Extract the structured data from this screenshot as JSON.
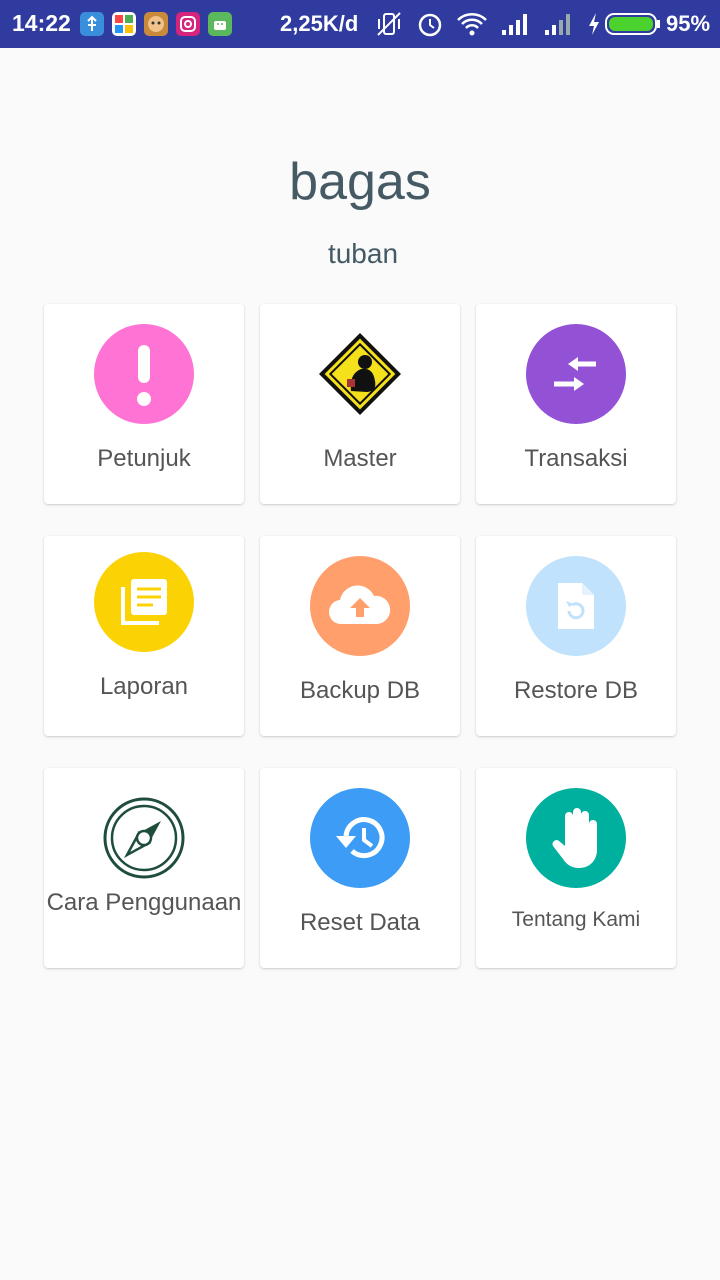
{
  "status_bar": {
    "time": "14:22",
    "net_speed": "2,25K/d",
    "battery": "95%",
    "icons": [
      "usb-icon",
      "app-icon",
      "game-icon",
      "instagram-icon",
      "android-icon",
      "vibrate-icon",
      "alarm-icon",
      "wifi-icon",
      "signal-icon",
      "signal-icon",
      "charging-icon",
      "battery-icon"
    ]
  },
  "header": {
    "title": "bagas",
    "subtitle": "tuban"
  },
  "menu": {
    "items": [
      {
        "label": "Petunjuk",
        "icon": "exclamation-icon",
        "color": "#ff73d4"
      },
      {
        "label": "Master",
        "icon": "warning-sign-icon",
        "color": "#f5e11b"
      },
      {
        "label": "Transaksi",
        "icon": "transfer-arrows-icon",
        "color": "#9352d6"
      },
      {
        "label": "Laporan",
        "icon": "report-document-icon",
        "color": "#fbd304"
      },
      {
        "label": "Backup DB",
        "icon": "cloud-upload-icon",
        "color": "#ff9f6b"
      },
      {
        "label": "Restore DB",
        "icon": "file-restore-icon",
        "color": "#c0e2fc"
      },
      {
        "label": "Cara Penggunaan",
        "icon": "compass-icon",
        "color": "#1f4d3b"
      },
      {
        "label": "Reset Data",
        "icon": "history-icon",
        "color": "#3d9cf5"
      },
      {
        "label": "Tentang Kami",
        "icon": "hand-icon",
        "color": "#00b09f"
      }
    ]
  }
}
